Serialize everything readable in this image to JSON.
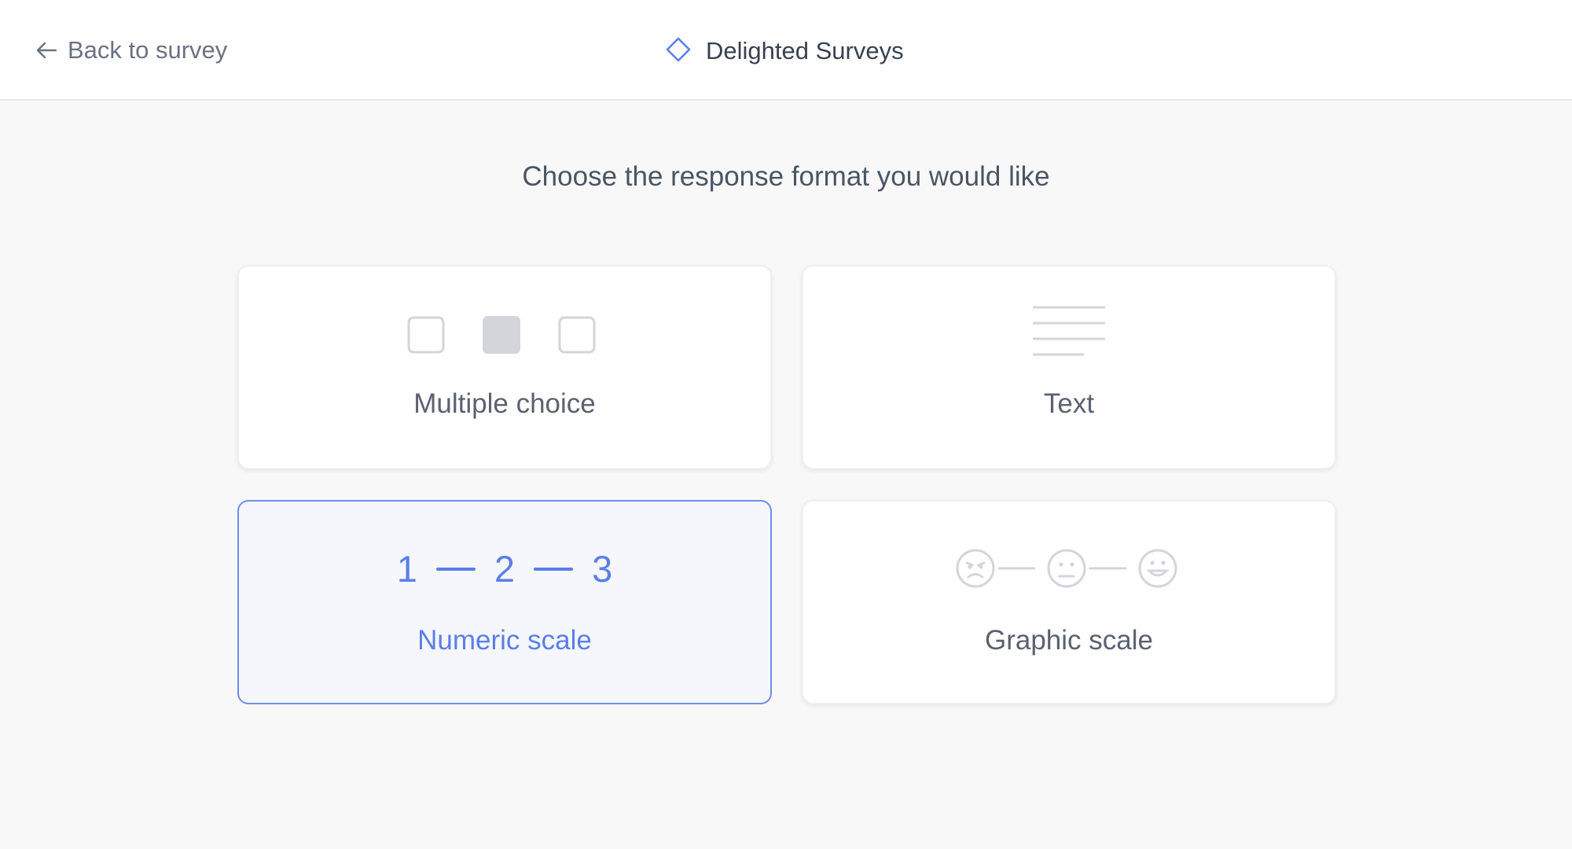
{
  "header": {
    "back_label": "Back to survey",
    "brand_name": "Delighted Surveys",
    "accent_color": "#5b7fe8"
  },
  "main": {
    "prompt": "Choose the response format you would like",
    "options": [
      {
        "label": "Multiple choice",
        "icon": "multiple-choice-icon",
        "selected": false
      },
      {
        "label": "Text",
        "icon": "text-lines-icon",
        "selected": false
      },
      {
        "label": "Numeric scale",
        "icon": "numeric-scale-icon",
        "selected": true,
        "scale": [
          "1",
          "2",
          "3"
        ]
      },
      {
        "label": "Graphic scale",
        "icon": "graphic-scale-icon",
        "selected": false
      }
    ]
  }
}
